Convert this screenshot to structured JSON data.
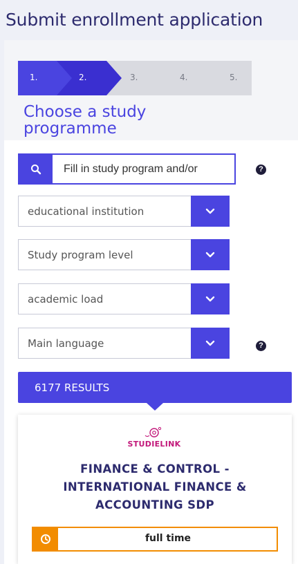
{
  "page": {
    "title": "Submit enrollment application"
  },
  "stepper": {
    "steps": [
      {
        "label": "1.",
        "state": "done"
      },
      {
        "label": "2.",
        "state": "active"
      },
      {
        "label": "3.",
        "state": "upcoming"
      },
      {
        "label": "4.",
        "state": "upcoming"
      },
      {
        "label": "5.",
        "state": "upcoming"
      }
    ]
  },
  "section": {
    "title": "Choose a study programme"
  },
  "search": {
    "placeholder": "Fill in study program and/or",
    "value": "",
    "icon": "search-icon"
  },
  "filters": [
    {
      "label": "educational institution",
      "icon": "chevron-down-icon"
    },
    {
      "label": "Study program level",
      "icon": "chevron-down-icon"
    },
    {
      "label": "academic load",
      "icon": "chevron-down-icon"
    },
    {
      "label": "Main language",
      "icon": "chevron-down-icon"
    }
  ],
  "help_icons": [
    "help-icon-search",
    "help-icon-language"
  ],
  "results": {
    "label": "6177 RESULTS"
  },
  "card": {
    "logo_text": "STUDIELINK",
    "title": "FINANCE & CONTROL - INTERNATIONAL FINANCE & ACCOUNTING SDP",
    "load_label": "full time",
    "load_icon": "clock-icon"
  },
  "colors": {
    "accent": "#4a44e0",
    "accent_dark": "#3a2fd0",
    "title": "#2d2b6e",
    "inactive_step": "#d9dae0",
    "badge": "#f28c00",
    "logo": "#c2187a"
  }
}
